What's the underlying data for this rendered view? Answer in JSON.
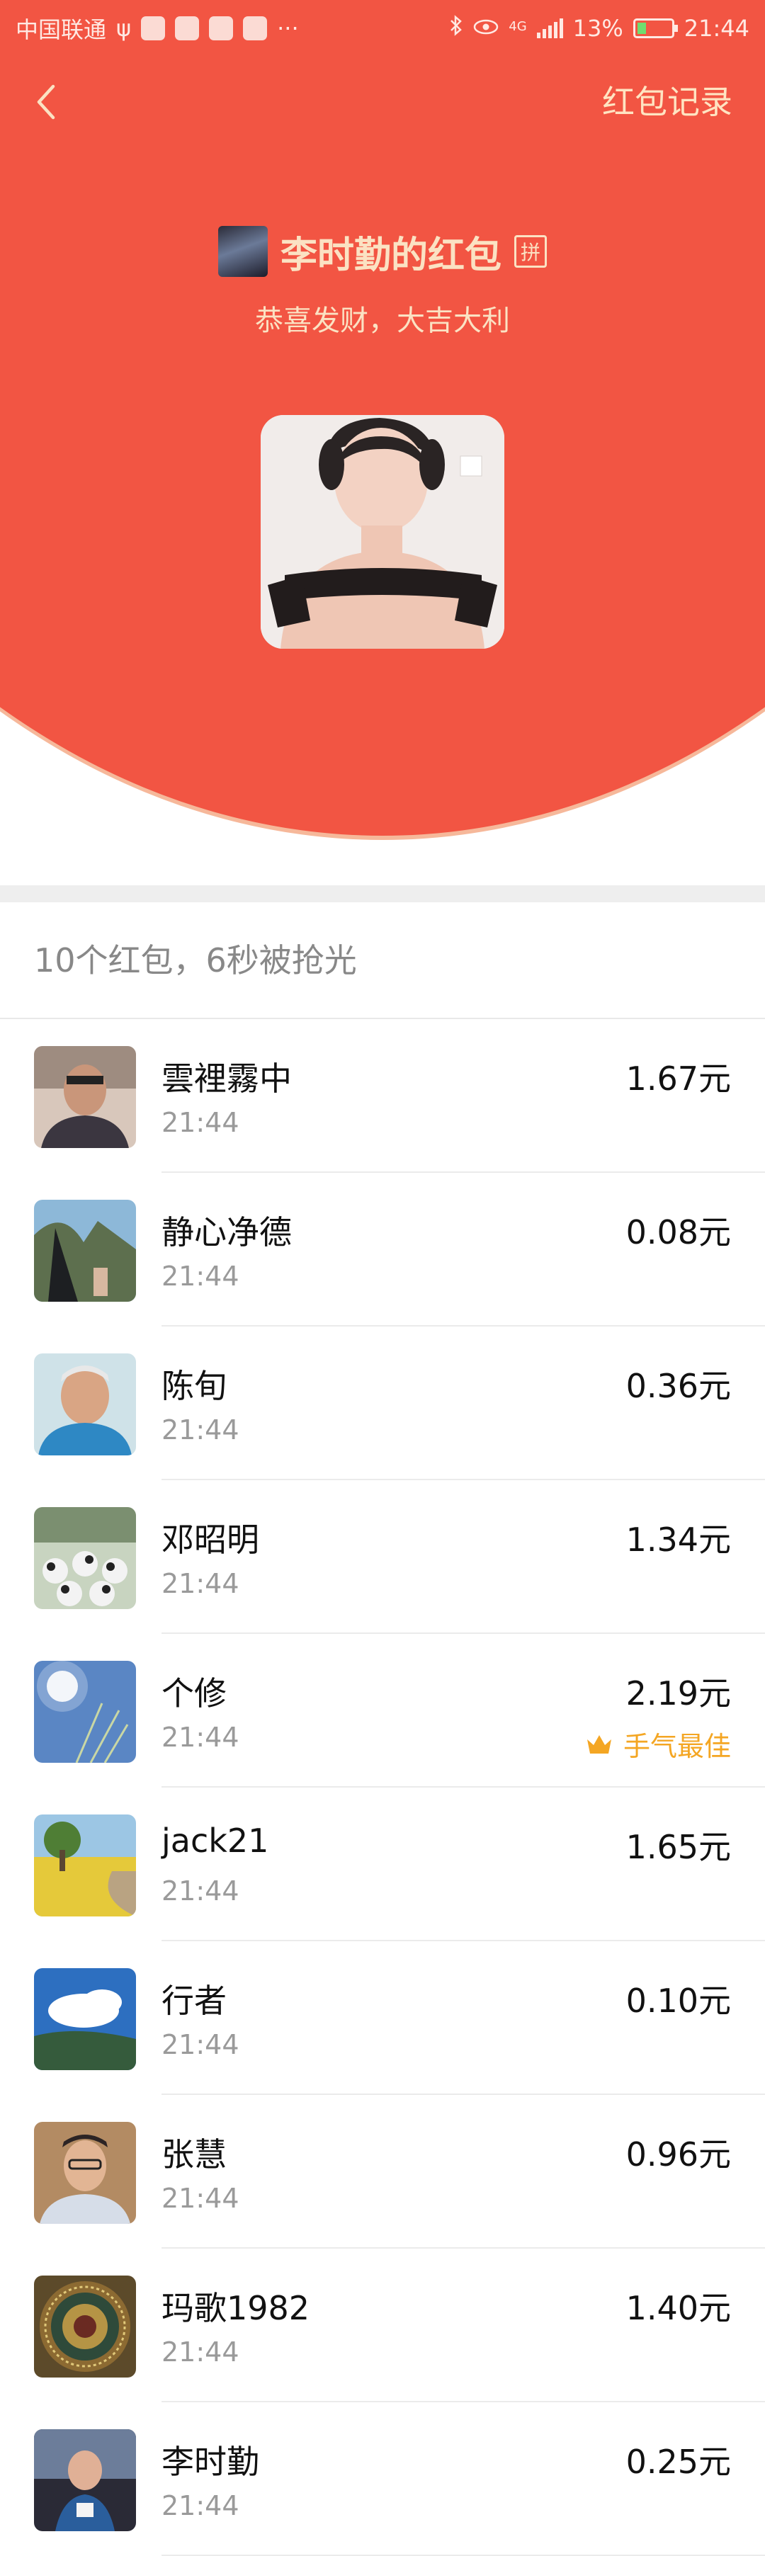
{
  "status_bar": {
    "carrier": "中国联通",
    "usb_symbol": "ψ",
    "more": "···",
    "network": "4G",
    "battery": "13%",
    "time": "21:44"
  },
  "header": {
    "records_label": "红包记录",
    "sender_title": "李时勤的红包",
    "pin_label": "拼",
    "greeting": "恭喜发财，大吉大利"
  },
  "summary": "10个红包，6秒被抢光",
  "records": [
    {
      "name": "雲裡霧中",
      "time": "21:44",
      "amount": "1.67元",
      "best": ""
    },
    {
      "name": "静心净德",
      "time": "21:44",
      "amount": "0.08元",
      "best": ""
    },
    {
      "name": "陈旬",
      "time": "21:44",
      "amount": "0.36元",
      "best": ""
    },
    {
      "name": "邓昭明",
      "time": "21:44",
      "amount": "1.34元",
      "best": ""
    },
    {
      "name": "个修",
      "time": "21:44",
      "amount": "2.19元",
      "best": "手气最佳"
    },
    {
      "name": "jack21",
      "time": "21:44",
      "amount": "1.65元",
      "best": ""
    },
    {
      "name": "行者",
      "time": "21:44",
      "amount": "0.10元",
      "best": ""
    },
    {
      "name": "张慧",
      "time": "21:44",
      "amount": "0.96元",
      "best": ""
    },
    {
      "name": "玛歌1982",
      "time": "21:44",
      "amount": "1.40元",
      "best": ""
    },
    {
      "name": "李时勤",
      "time": "21:44",
      "amount": "0.25元",
      "best": ""
    }
  ],
  "colors": {
    "header_red": "#f25543",
    "header_text": "#fbe2c3",
    "best_gold": "#f4a623"
  },
  "icons": {
    "back": "chevron-left-icon",
    "best": "crown-icon"
  }
}
